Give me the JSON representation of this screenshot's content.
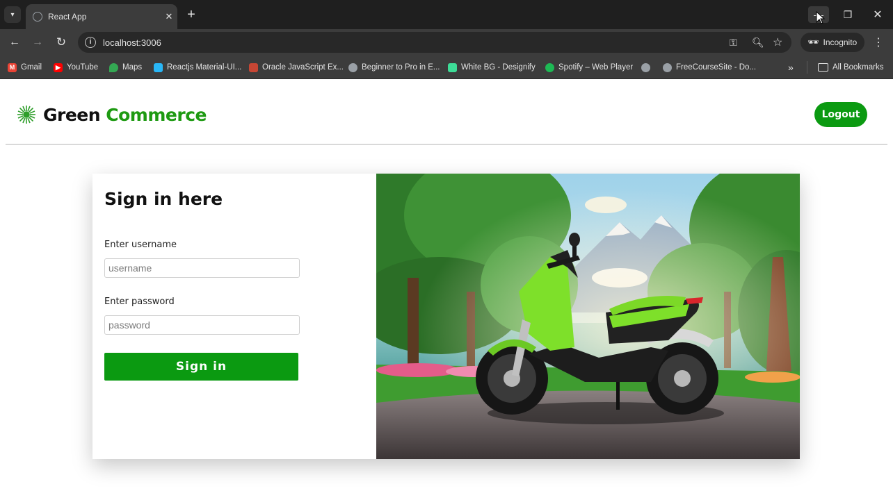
{
  "browser": {
    "tab_title": "React App",
    "url": "localhost:3006",
    "incognito_label": "Incognito",
    "bookmarks": [
      {
        "label": "Gmail",
        "icon": "gmail-icon",
        "color": "#ea4335"
      },
      {
        "label": "YouTube",
        "icon": "youtube-icon",
        "color": "#ff0000"
      },
      {
        "label": "Maps",
        "icon": "maps-icon",
        "color": "#34a853"
      },
      {
        "label": "Reactjs Material-UI...",
        "icon": "material-ui-icon",
        "color": "#29b6f6"
      },
      {
        "label": "Oracle JavaScript Ex...",
        "icon": "oracle-icon",
        "color": "#c74634"
      },
      {
        "label": "Beginner to Pro in E...",
        "icon": "globe-icon",
        "color": "#9aa0a6"
      },
      {
        "label": "White BG - Designify",
        "icon": "designify-icon",
        "color": "#3ddc97"
      },
      {
        "label": "Spotify – Web Player",
        "icon": "spotify-icon",
        "color": "#1db954"
      },
      {
        "label": "",
        "icon": "globe-icon",
        "color": "#9aa0a6"
      },
      {
        "label": "FreeCourseSite - Do...",
        "icon": "globe-icon",
        "color": "#9aa0a6"
      }
    ],
    "all_bookmarks_label": "All Bookmarks"
  },
  "header": {
    "brand_first": "Green",
    "brand_second": "Commerce",
    "logout_label": "Logout",
    "accent_color": "#0b9a11"
  },
  "login": {
    "title": "Sign in here",
    "username_label": "Enter username",
    "username_placeholder": "username",
    "password_label": "Enter password",
    "password_placeholder": "password",
    "submit_label": "Sign in"
  }
}
